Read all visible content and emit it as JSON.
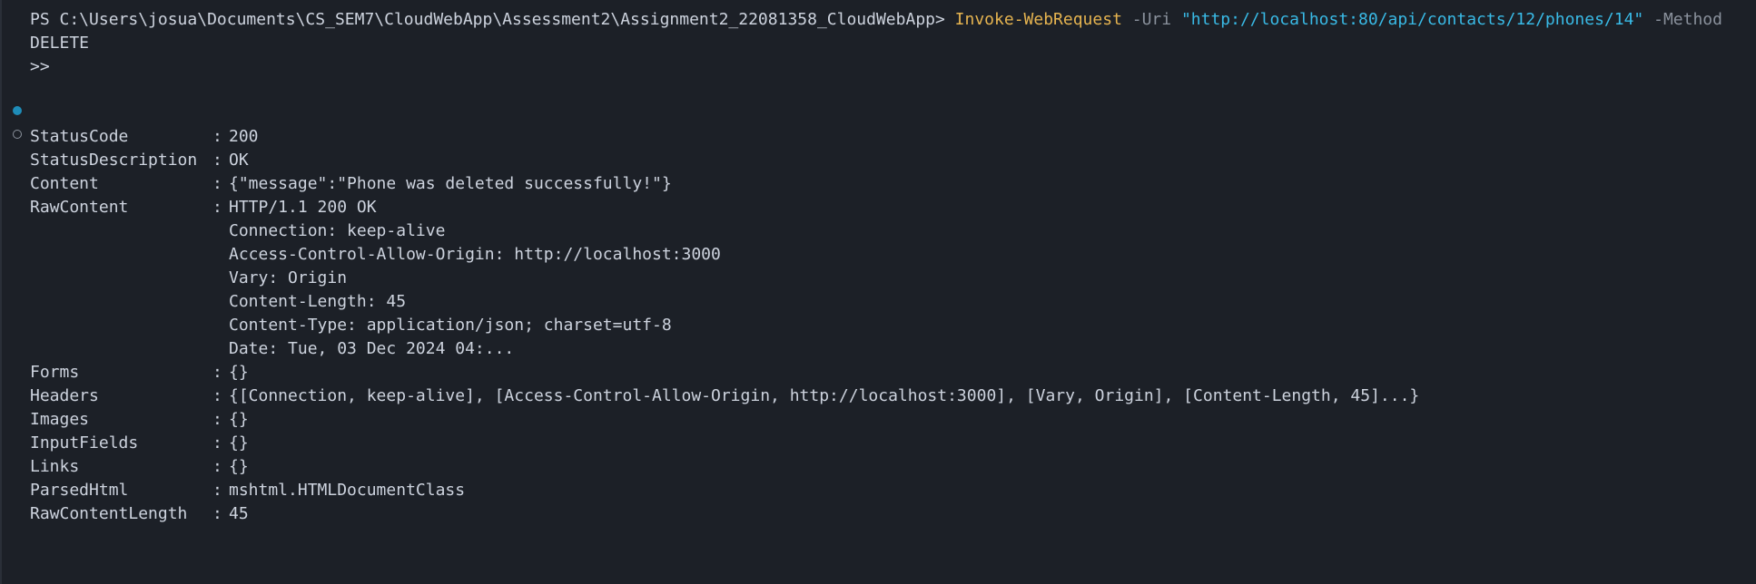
{
  "command": {
    "prompt": "PS C:\\Users\\josua\\Documents\\CS_SEM7\\CloudWebApp\\Assessment2\\Assignment2_22081358_CloudWebApp> ",
    "cmdlet": "Invoke-WebRequest",
    "uri_flag": " -Uri ",
    "uri": "\"http://localhost:80/api/contacts/12/phones/14\"",
    "method_flag": " -Method",
    "method_value": "DELETE",
    "continuation": ">>"
  },
  "output": {
    "status_code": {
      "name": "StatusCode",
      "value": "200"
    },
    "status_description": {
      "name": "StatusDescription",
      "value": "OK"
    },
    "content": {
      "name": "Content",
      "value": "{\"message\":\"Phone was deleted successfully!\"}"
    },
    "raw_content": {
      "name": "RawContent",
      "lines": [
        "HTTP/1.1 200 OK",
        "Connection: keep-alive",
        "Access-Control-Allow-Origin: http://localhost:3000",
        "Vary: Origin",
        "Content-Length: 45",
        "Content-Type: application/json; charset=utf-8",
        "Date: Tue, 03 Dec 2024 04:..."
      ]
    },
    "forms": {
      "name": "Forms",
      "value": "{}"
    },
    "headers": {
      "name": "Headers",
      "value": "{[Connection, keep-alive], [Access-Control-Allow-Origin, http://localhost:3000], [Vary, Origin], [Content-Length, 45]...}"
    },
    "images": {
      "name": "Images",
      "value": "{}"
    },
    "input_fields": {
      "name": "InputFields",
      "value": "{}"
    },
    "links": {
      "name": "Links",
      "value": "{}"
    },
    "parsed_html": {
      "name": "ParsedHtml",
      "value": "mshtml.HTMLDocumentClass"
    },
    "raw_content_length": {
      "name": "RawContentLength",
      "value": "45"
    },
    "separator": ":"
  },
  "colors": {
    "background": "#1c2027",
    "text": "#cdd3de",
    "cmdlet": "#e6b450",
    "parameter": "#8a919c",
    "string": "#39bae6",
    "success_dot": "#1e8cb8"
  }
}
